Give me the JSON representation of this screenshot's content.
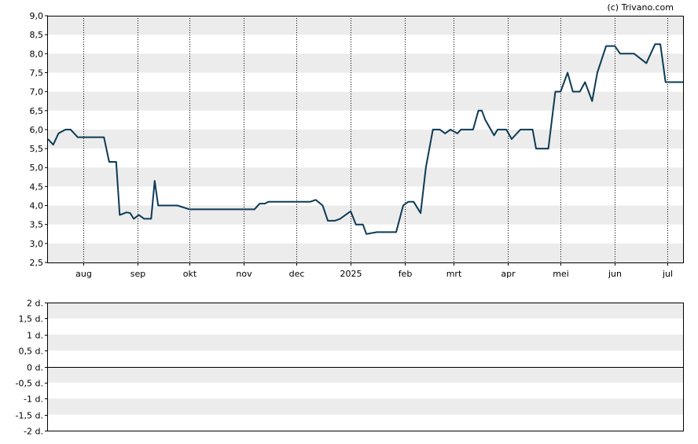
{
  "credit": "(c) Trivano.com",
  "colors": {
    "line": "#0d3a56",
    "band": "#ececec",
    "frame": "#000000",
    "grid": "#000000"
  },
  "chart_data": [
    {
      "type": "line",
      "title": "",
      "xlabel": "",
      "ylabel": "",
      "ylim": [
        2.5,
        9.0
      ],
      "y_ticks": [
        "2,5",
        "3,0",
        "3,5",
        "4,0",
        "4,5",
        "5,0",
        "5,5",
        "6,0",
        "6,5",
        "7,0",
        "7,5",
        "8,0",
        "8,5",
        "9,0"
      ],
      "x_ticks": [
        "aug",
        "sep",
        "okt",
        "nov",
        "dec",
        "2025",
        "feb",
        "mrt",
        "apr",
        "mei",
        "jun",
        "jul"
      ],
      "x_tick_dates": [
        "2024-08-01",
        "2024-09-01",
        "2024-10-01",
        "2024-11-01",
        "2024-12-01",
        "2025-01-01",
        "2025-02-01",
        "2025-03-01",
        "2025-04-01",
        "2025-05-01",
        "2025-06-01",
        "2025-07-01"
      ],
      "xlim": [
        "2024-07-12",
        "2025-07-10"
      ],
      "grid": "vertical dotted at month ticks, alternating horizontal bands",
      "series": [
        {
          "x": [
            "2024-07-12",
            "2024-07-15",
            "2024-07-18",
            "2024-07-22",
            "2024-07-25",
            "2024-07-29",
            "2024-08-05",
            "2024-08-13",
            "2024-08-16",
            "2024-08-20",
            "2024-08-22",
            "2024-08-26",
            "2024-08-28",
            "2024-08-30",
            "2024-09-02",
            "2024-09-05",
            "2024-09-09",
            "2024-09-11",
            "2024-09-13",
            "2024-09-20",
            "2024-09-24",
            "2024-10-01",
            "2024-10-15",
            "2024-10-22",
            "2024-10-30",
            "2024-11-01",
            "2024-11-04",
            "2024-11-07",
            "2024-11-10",
            "2024-11-13",
            "2024-11-15",
            "2024-11-18",
            "2024-11-21",
            "2024-11-26",
            "2024-12-01",
            "2024-12-04",
            "2024-12-09",
            "2024-12-12",
            "2024-12-16",
            "2024-12-19",
            "2024-12-23",
            "2024-12-26",
            "2025-01-01",
            "2025-01-04",
            "2025-01-08",
            "2025-01-10",
            "2025-01-16",
            "2025-01-23",
            "2025-01-27",
            "2025-01-31",
            "2025-02-03",
            "2025-02-06",
            "2025-02-10",
            "2025-02-13",
            "2025-02-17",
            "2025-02-19",
            "2025-02-21",
            "2025-02-24",
            "2025-02-27",
            "2025-03-03",
            "2025-03-05",
            "2025-03-09",
            "2025-03-12",
            "2025-03-15",
            "2025-03-17",
            "2025-03-19",
            "2025-03-24",
            "2025-03-26",
            "2025-03-31",
            "2025-04-03",
            "2025-04-08",
            "2025-04-11",
            "2025-04-15",
            "2025-04-17",
            "2025-04-21",
            "2025-04-24",
            "2025-04-28",
            "2025-05-01",
            "2025-05-05",
            "2025-05-08",
            "2025-05-12",
            "2025-05-15",
            "2025-05-19",
            "2025-05-22",
            "2025-05-27",
            "2025-06-01",
            "2025-06-04",
            "2025-06-09",
            "2025-06-12",
            "2025-06-19",
            "2025-06-24",
            "2025-06-27",
            "2025-06-30",
            "2025-07-03",
            "2025-07-06",
            "2025-07-10"
          ],
          "y": [
            5.75,
            5.6,
            5.9,
            6.0,
            6.0,
            5.8,
            5.8,
            5.8,
            5.15,
            5.15,
            3.75,
            3.82,
            3.8,
            3.65,
            3.75,
            3.65,
            3.65,
            4.65,
            4.0,
            4.0,
            4.0,
            3.9,
            3.9,
            3.9,
            3.9,
            3.9,
            3.9,
            3.9,
            4.05,
            4.05,
            4.1,
            4.1,
            4.1,
            4.1,
            4.1,
            4.1,
            4.1,
            4.15,
            4.0,
            3.6,
            3.6,
            3.65,
            3.85,
            3.5,
            3.5,
            3.25,
            3.3,
            3.3,
            3.3,
            4.0,
            4.1,
            4.1,
            3.8,
            5.0,
            6.0,
            6.0,
            6.0,
            5.9,
            6.0,
            5.9,
            6.0,
            6.0,
            6.0,
            6.5,
            6.5,
            6.25,
            5.85,
            6.0,
            6.0,
            5.75,
            6.0,
            6.0,
            6.0,
            5.5,
            5.5,
            5.5,
            7.0,
            7.0,
            7.5,
            7.0,
            7.0,
            7.25,
            6.75,
            7.5,
            8.2,
            8.2,
            8.0,
            8.0,
            8.0,
            7.75,
            8.25,
            8.25,
            7.25,
            7.25,
            7.25,
            7.25
          ]
        }
      ]
    },
    {
      "type": "line",
      "title": "",
      "xlabel": "",
      "ylabel": "",
      "ylim": [
        -2,
        2
      ],
      "y_ticks": [
        "2 d.",
        "1,5 d.",
        "1 d.",
        "0,5 d.",
        "0 d.",
        "-0,5 d.",
        "-1 d.",
        "-1,5 d.",
        "-2 d."
      ],
      "y_tick_values": [
        2,
        1.5,
        1,
        0.5,
        0,
        -0.5,
        -1,
        -1.5,
        -2
      ],
      "grid": "alternating horizontal bands, baseline at 0",
      "series": []
    }
  ]
}
